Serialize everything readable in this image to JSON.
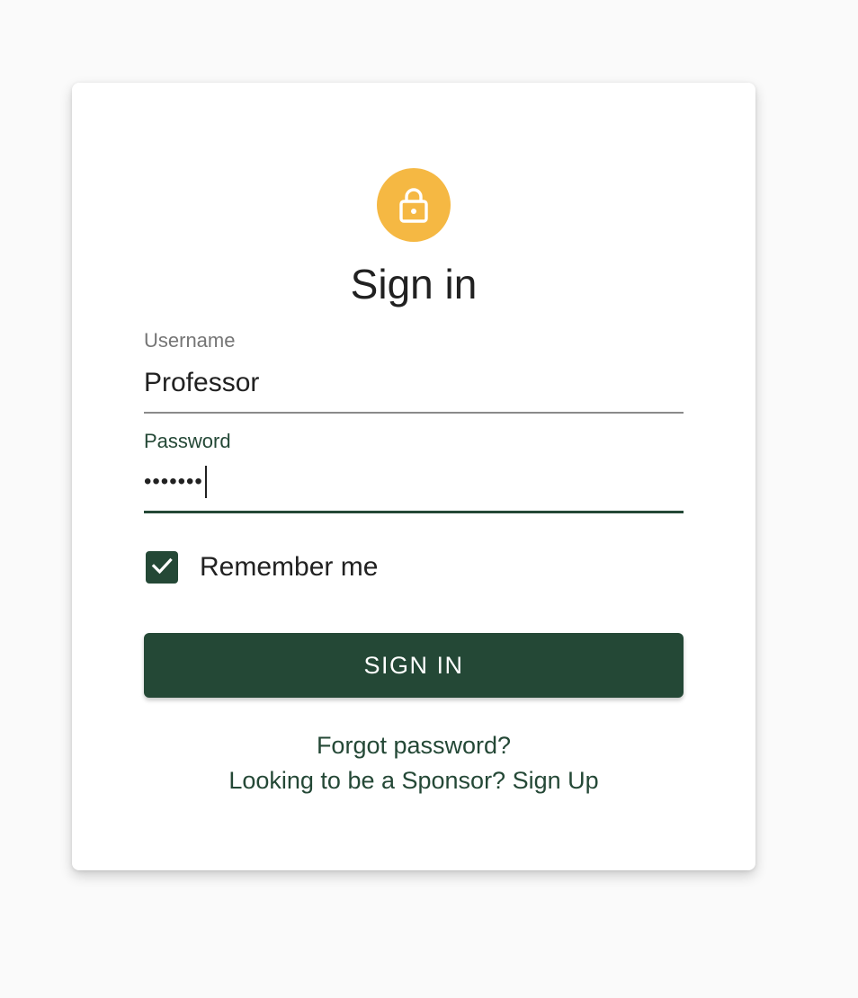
{
  "colors": {
    "accent": "#244836",
    "avatar": "#f5b843",
    "card_background": "#ffffff",
    "page_background": "#fafafa"
  },
  "header": {
    "icon": "lock-icon",
    "title": "Sign in"
  },
  "form": {
    "username": {
      "label": "Username",
      "value": "Professor"
    },
    "password": {
      "label": "Password",
      "masked_value": "•••••••"
    },
    "remember": {
      "label": "Remember me",
      "checked": true
    },
    "submit_label": "SIGN IN"
  },
  "links": {
    "forgot": "Forgot password?",
    "signup": "Looking to be a Sponsor? Sign Up"
  }
}
